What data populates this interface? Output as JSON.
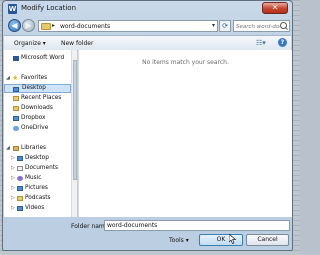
{
  "window": {
    "title": "Modify Location",
    "app_icon_letter": "W"
  },
  "nav": {
    "path": "word-documents",
    "search_placeholder": "Search word-documents"
  },
  "toolbar": {
    "organize_label": "Organize ▾",
    "new_folder_label": "New folder"
  },
  "sidebar": {
    "top_item": "Microsoft Word",
    "favorites_header": "Favorites",
    "favorites": [
      "Desktop",
      "Recent Places",
      "Downloads",
      "Dropbox",
      "OneDrive"
    ],
    "libraries_header": "Libraries",
    "libraries": [
      "Desktop",
      "Documents",
      "Music",
      "Pictures",
      "Podcasts",
      "Videos"
    ]
  },
  "content": {
    "empty_message": "No items match your search."
  },
  "footer": {
    "folder_name_label": "Folder name:",
    "folder_name_value": "word-documents",
    "tools_label": "Tools ▾",
    "ok_label": "OK",
    "cancel_label": "Cancel"
  }
}
